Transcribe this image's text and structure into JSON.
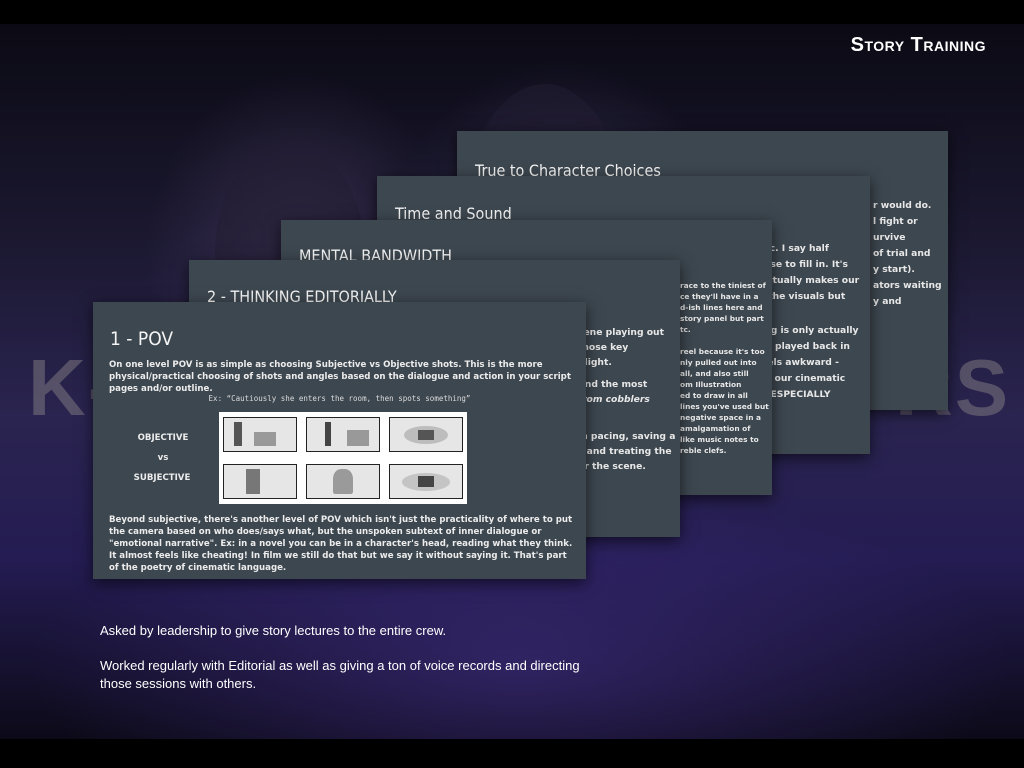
{
  "page": {
    "title": "Story Training",
    "background_word": "K-",
    "background_word_right": "RS"
  },
  "slides": {
    "true_to_character": {
      "title": "True to Character Choices",
      "lines": [
        "r would do.",
        "l fight or",
        "urvive",
        "of trial and",
        "y start).",
        "ators waiting",
        "y and"
      ]
    },
    "time_and_sound": {
      "title": "Time and Sound",
      "lines": [
        "sic. I say half",
        "else to fill in. It's",
        "actually makes our",
        "f the visuals but",
        "ing is only actually",
        "or played back in",
        "eels awkward -",
        "of our cinematic",
        "e ESPECIALLY"
      ]
    },
    "mental_bandwidth": {
      "title": "MENTAL BANDWIDTH",
      "lines": [
        "race to the tiniest of",
        "ce they'll have in a",
        "d-ish lines here and",
        "story panel but part",
        "tc.",
        "reel because it's too",
        "nly pulled out into",
        "all, and also still",
        "om Illustration",
        "ed to draw in all",
        "lines you've used but",
        "negative space in a",
        "amalgamation of",
        "like music notes to",
        "reble clefs."
      ]
    },
    "thinking_editorially": {
      "title": "2 - THINKING EDITORIALLY",
      "lines": [
        "cene playing out",
        "those key",
        "hlight.",
        "find the most",
        "from cobblers",
        "in pacing, saving a",
        "s and treating the",
        "or the scene."
      ]
    },
    "pov": {
      "title": "1 - POV",
      "intro": "On one level POV is as simple as choosing Subjective vs Objective shots. This is the more physical/practical choosing of shots and angles based on the dialogue and action in your script pages and/or outline.",
      "example": "Ex: “Cautiously she enters the room, then spots something”",
      "label_objective": "OBJECTIVE",
      "label_vs": "vs",
      "label_subjective": "SUBJECTIVE",
      "body": "Beyond subjective, there's another level of POV which isn't just the practicality of where to put the camera based on who does/says what, but the unspoken subtext of inner dialogue or \"emotional narrative\". Ex: in a novel you can be in a character's head, reading what they think. It almost feels like cheating! In film we still do that but we say it without saying it. That's part of the poetry of cinematic language."
    }
  },
  "captions": {
    "line1": "Asked by leadership to give story lectures to the entire crew.",
    "line2": "Worked regularly with Editorial as well as giving a ton of voice records and directing those sessions with others."
  },
  "colors": {
    "card_bg": "#3d474f",
    "accent_text": "#ffffff"
  }
}
